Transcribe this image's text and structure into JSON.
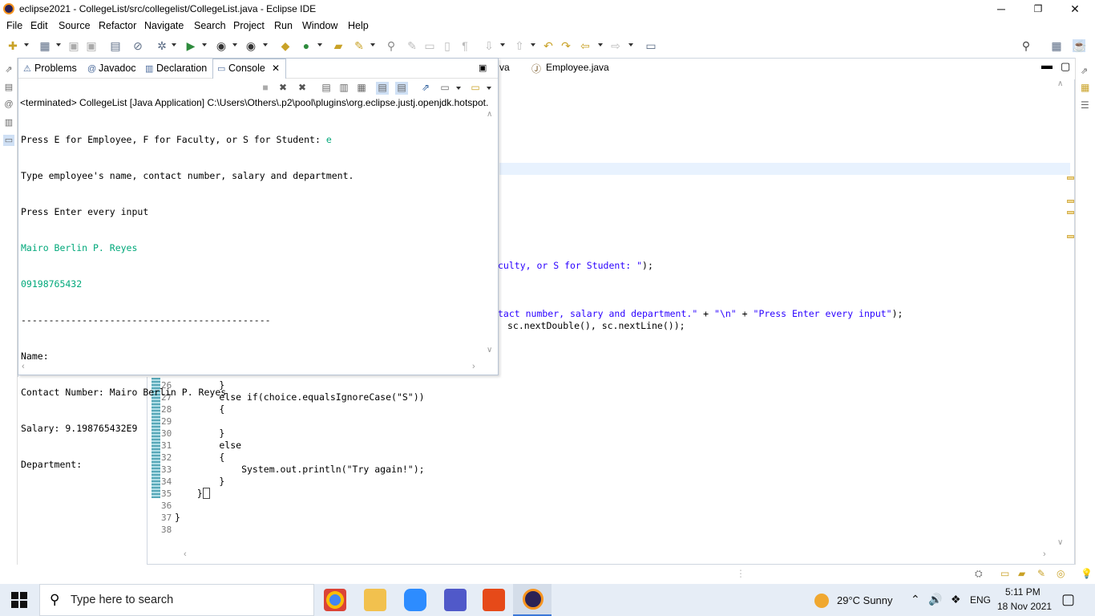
{
  "window": {
    "title": "eclipse2021 - CollegeList/src/collegelist/CollegeList.java - Eclipse IDE",
    "minimize": "─",
    "maximize": "❐",
    "close": "✕"
  },
  "menu": [
    "File",
    "Edit",
    "Source",
    "Refactor",
    "Navigate",
    "Search",
    "Project",
    "Run",
    "Window",
    "Help"
  ],
  "console_view": {
    "tabs": [
      {
        "label": "Problems",
        "icon": "problems-icon"
      },
      {
        "label": "Javadoc",
        "icon": "at-icon"
      },
      {
        "label": "Declaration",
        "icon": "declaration-icon"
      },
      {
        "label": "Console",
        "icon": "console-icon"
      }
    ],
    "close_glyph": "✕",
    "description": "<terminated> CollegeList [Java Application] C:\\Users\\Others\\.p2\\pool\\plugins\\org.eclipse.justj.openjdk.hotspot.",
    "output": [
      {
        "text": "Press E for Employee, F for Faculty, or S for Student: ",
        "input": "e"
      },
      {
        "text": "Type employee's name, contact number, salary and department.",
        "input": ""
      },
      {
        "text": "Press Enter every input",
        "input": ""
      },
      {
        "text": "",
        "input": "Mairo Berlin P. Reyes"
      },
      {
        "text": "",
        "input": "09198765432"
      },
      {
        "text": "---------------------------------------------",
        "input": ""
      },
      {
        "text": "Name: ",
        "input": ""
      },
      {
        "text": "Contact Number: Mairo Berlin P. Reyes",
        "input": ""
      },
      {
        "text": "Salary: 9.198765432E9",
        "input": ""
      },
      {
        "text": "Department: ",
        "input": ""
      }
    ]
  },
  "editor": {
    "tabs": [
      {
        "label": "va"
      },
      {
        "label": "Employee.java"
      }
    ],
    "visible_code_fragments": [
      "culty, or S for Student: \");",
      "tact number, salary and department.\" + \"\\n\" + \"Press Enter every input\");",
      "sc.nextDouble(), sc.nextLine());"
    ],
    "lines": [
      {
        "no": "26",
        "code": "        }"
      },
      {
        "no": "27",
        "code": "        else if(choice.equalsIgnoreCase(\"S\"))"
      },
      {
        "no": "28",
        "code": "        {"
      },
      {
        "no": "29",
        "code": ""
      },
      {
        "no": "30",
        "code": "        }"
      },
      {
        "no": "31",
        "code": "        else"
      },
      {
        "no": "32",
        "code": "        {"
      },
      {
        "no": "33",
        "code": "            System.out.println(\"Try again!\");"
      },
      {
        "no": "34",
        "code": "        }"
      },
      {
        "no": "35",
        "code": "    }"
      },
      {
        "no": "36",
        "code": ""
      },
      {
        "no": "37",
        "code": "}"
      },
      {
        "no": "38",
        "code": ""
      }
    ]
  },
  "taskbar": {
    "search_placeholder": "Type here to search",
    "weather": "29°C  Sunny",
    "language": "ENG",
    "time": "5:11 PM",
    "date": "18 Nov 2021"
  },
  "colors": {
    "console_input": "#00a87a",
    "string": "#2a00ff",
    "taskbar": "#e6edf6"
  }
}
